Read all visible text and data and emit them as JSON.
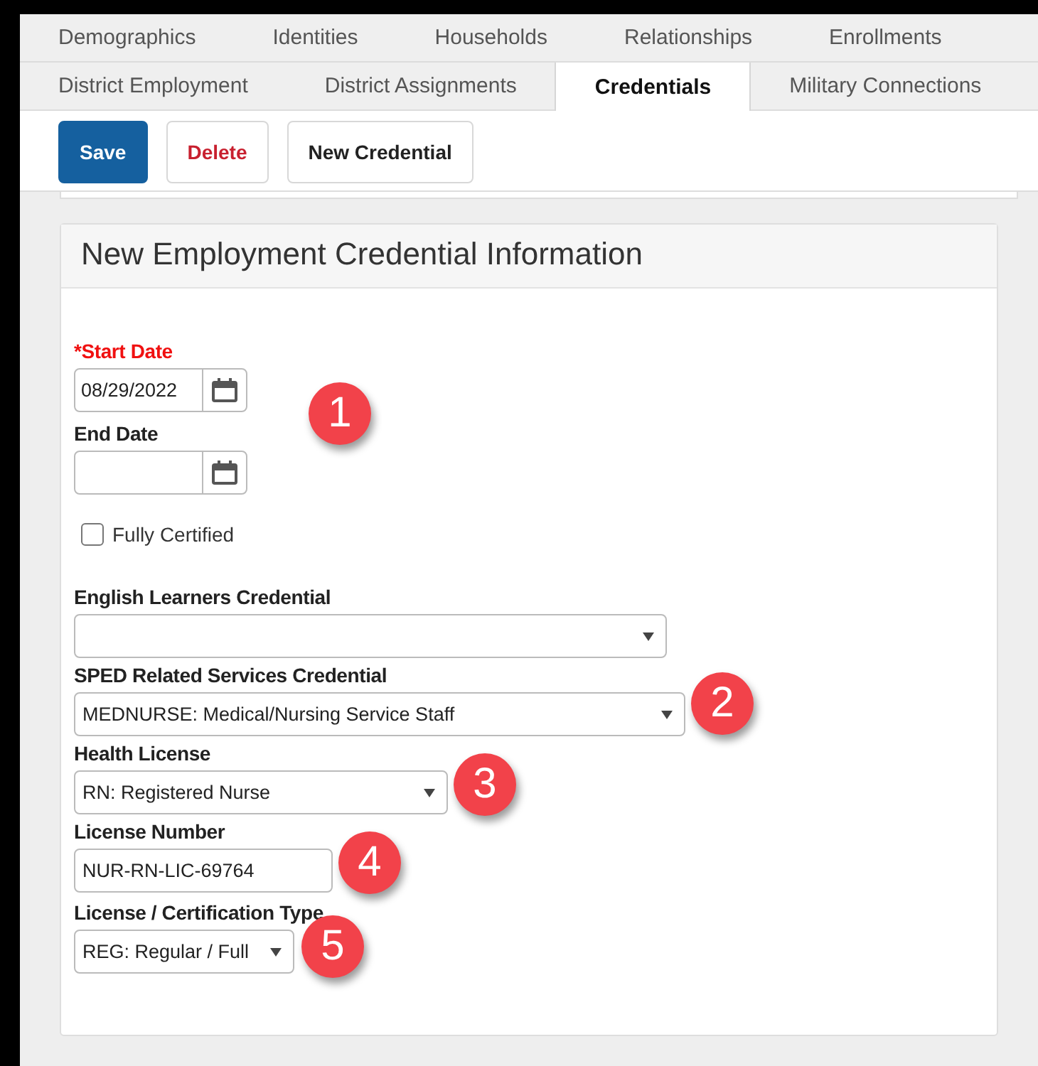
{
  "tab_rows": [
    [
      {
        "label": "Demographics",
        "selected": false
      },
      {
        "label": "Identities",
        "selected": false
      },
      {
        "label": "Households",
        "selected": false
      },
      {
        "label": "Relationships",
        "selected": false
      },
      {
        "label": "Enrollments",
        "selected": false
      }
    ],
    [
      {
        "label": "District Employment",
        "selected": false
      },
      {
        "label": "District Assignments",
        "selected": false
      },
      {
        "label": "Credentials",
        "selected": true
      },
      {
        "label": "Military Connections",
        "selected": false
      }
    ]
  ],
  "toolbar": [
    {
      "label": "Save",
      "kind": "primary"
    },
    {
      "label": "Delete",
      "kind": "danger"
    },
    {
      "label": "New Credential",
      "kind": "default"
    }
  ],
  "panel": {
    "title": "New Employment Credential Information",
    "fields": [
      {
        "kind": "date",
        "label": "*Start Date",
        "required": true,
        "value": "08/29/2022",
        "badge": "1"
      },
      {
        "kind": "date",
        "label": "End Date",
        "required": false
      },
      {
        "kind": "checkbox",
        "label": "Fully Certified",
        "checked": false
      },
      {
        "kind": "select",
        "label": "English Learners Credential"
      },
      {
        "kind": "select",
        "label": "SPED Related Services Credential",
        "value": "MEDNURSE: Medical/Nursing Service Staff",
        "badge": "2"
      },
      {
        "kind": "select",
        "label": "Health License",
        "value": "RN: Registered Nurse",
        "badge": "3"
      },
      {
        "kind": "text",
        "label": "License Number",
        "value": "NUR-RN-LIC-69764",
        "badge": "4"
      },
      {
        "kind": "select",
        "label": "License / Certification Type",
        "value": "REG: Regular / Full",
        "badge": "5"
      }
    ]
  }
}
